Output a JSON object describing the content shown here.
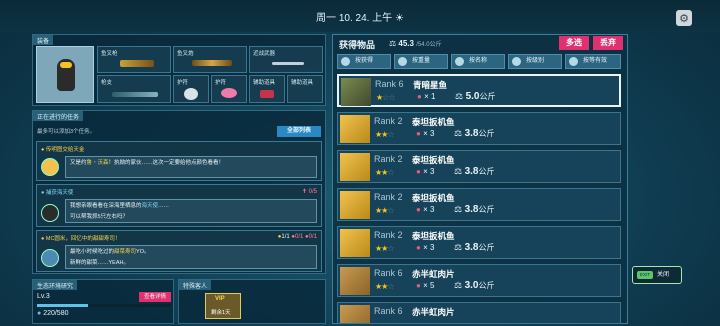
{
  "topbar": {
    "date": "周一 10. 24. 上午",
    "weather_icon": "weather-icon"
  },
  "equipment": {
    "title": "装备",
    "slots": [
      {
        "label": "鱼叉枪"
      },
      {
        "label": "鱼叉炮"
      },
      {
        "label": "近战武器"
      },
      {
        "label": "枪支"
      },
      {
        "label": "护符"
      },
      {
        "label": "护符"
      },
      {
        "label": "辅助道具"
      },
      {
        "label": "辅助道具"
      }
    ]
  },
  "tasks": {
    "title": "正在进行的任务",
    "subtitle": "最多可以添加3个任务。",
    "list_button": "全部列表",
    "items": [
      {
        "head": "传明图交给天金",
        "text_a": "又是约",
        "highlight": "鲁・沃森",
        "text_b": "！执拗的家伙……这次一定要给他点颜色看看！",
        "progress": ""
      },
      {
        "head": "捕获海天使",
        "text_a": "我想亲眼看看在深海里栖息的",
        "highlight": "海天使",
        "text_b": "……",
        "line2": "可以帮我抓5只左右吗？",
        "progress": "0/5"
      },
      {
        "head": "MC圆米，回忆中的甜甜寿司！",
        "text_a": "最吃小时候吃过的",
        "highlight": "甜菜寿司",
        "text_b": "YO。",
        "line2": "新鲜的甜菜……YEAH。",
        "progress": [
          "1/1",
          "0/1",
          "0/1"
        ]
      }
    ]
  },
  "eco": {
    "title": "生态环境研究",
    "level": "Lv.3",
    "button": "查看详情",
    "progress": "220/580",
    "progress_fraction": 0.379
  },
  "special": {
    "title": "特殊客人",
    "badge": "VIP",
    "days": "剩余1天"
  },
  "inventory": {
    "title": "获得物品",
    "weight": "45.3",
    "weight_max": "/54.0公斤",
    "multi_select": "多选",
    "discard": "丢弃",
    "sort_tabs": [
      "按获得",
      "按重量",
      "按名称",
      "按级别",
      "按等有效"
    ],
    "items": [
      {
        "rank": "Rank 6",
        "name": "青暗星鱼",
        "stars": 1,
        "count": "1",
        "kg": "5.0",
        "unit": "公斤"
      },
      {
        "rank": "Rank 2",
        "name": "泰坦扳机鱼",
        "stars": 2,
        "count": "3",
        "kg": "3.8",
        "unit": "公斤"
      },
      {
        "rank": "Rank 2",
        "name": "泰坦扳机鱼",
        "stars": 2,
        "count": "3",
        "kg": "3.8",
        "unit": "公斤"
      },
      {
        "rank": "Rank 2",
        "name": "泰坦扳机鱼",
        "stars": 2,
        "count": "3",
        "kg": "3.8",
        "unit": "公斤"
      },
      {
        "rank": "Rank 2",
        "name": "泰坦扳机鱼",
        "stars": 2,
        "count": "3",
        "kg": "3.8",
        "unit": "公斤"
      },
      {
        "rank": "Rank 6",
        "name": "赤半虹肉片",
        "stars": 2,
        "count": "5",
        "kg": "3.0",
        "unit": "公斤"
      },
      {
        "rank": "Rank 6",
        "name": "赤半虹肉片",
        "stars": 2,
        "count": "",
        "kg": "",
        "unit": ""
      }
    ]
  },
  "close_button": {
    "badge": "EXIT",
    "label": "关闭"
  },
  "colors": {
    "accent": "#e0306f",
    "star": "#f2c81e",
    "panel": "#17435a"
  }
}
